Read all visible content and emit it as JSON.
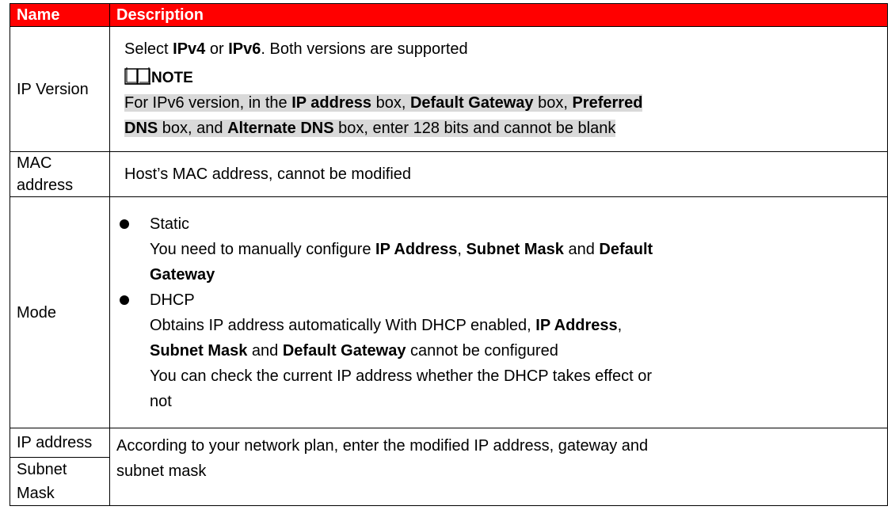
{
  "header": {
    "name": "Name",
    "description": "Description"
  },
  "rows": {
    "ip_version": {
      "name": "IP Version",
      "line1_a": "Select ",
      "line1_b": "IPv4",
      "line1_c": " or ",
      "line1_d": "IPv6",
      "line1_e": ". Both versions are supported",
      "note_label": "NOTE",
      "note1_a": "For IPv6 version, in the ",
      "note1_b": "IP address",
      "note1_c": " box, ",
      "note1_d": "Default Gateway",
      "note1_e": " box, ",
      "note1_f": "Preferred",
      "note2_a": "DNS",
      "note2_b": " box, and ",
      "note2_c": "Alternate DNS",
      "note2_d": " box, enter 128 bits and cannot be blank"
    },
    "mac": {
      "name": "MAC address",
      "desc": "Host’s MAC address, cannot be modified"
    },
    "mode": {
      "name": "Mode",
      "static_label": "Static",
      "static1_a": "You need to manually configure ",
      "static1_b": "IP Address",
      "static1_c": ", ",
      "static1_d": "Subnet Mask",
      "static1_e": " and ",
      "static1_f": "Default",
      "static2": "Gateway",
      "dhcp_label": "DHCP",
      "dhcp1_a": "Obtains IP address automatically With DHCP enabled, ",
      "dhcp1_b": "IP Address",
      "dhcp1_c": ",",
      "dhcp2_a": "Subnet Mask",
      "dhcp2_b": " and ",
      "dhcp2_c": "Default Gateway",
      "dhcp2_d": " cannot be configured",
      "dhcp3": "You can check the current IP address whether the DHCP takes effect or",
      "dhcp4": "not"
    },
    "ip_address": {
      "name": "IP address",
      "desc1": "According to your network plan, enter the modified IP address, gateway and",
      "desc2": "subnet mask"
    },
    "subnet_mask": {
      "name": "Subnet Mask"
    }
  },
  "icons": {
    "note": "book-icon",
    "bullet": "bullet-icon"
  },
  "colors": {
    "header_bg": "#ff0000",
    "header_text": "#ffffff",
    "note_highlight": "#d9d9d9"
  }
}
